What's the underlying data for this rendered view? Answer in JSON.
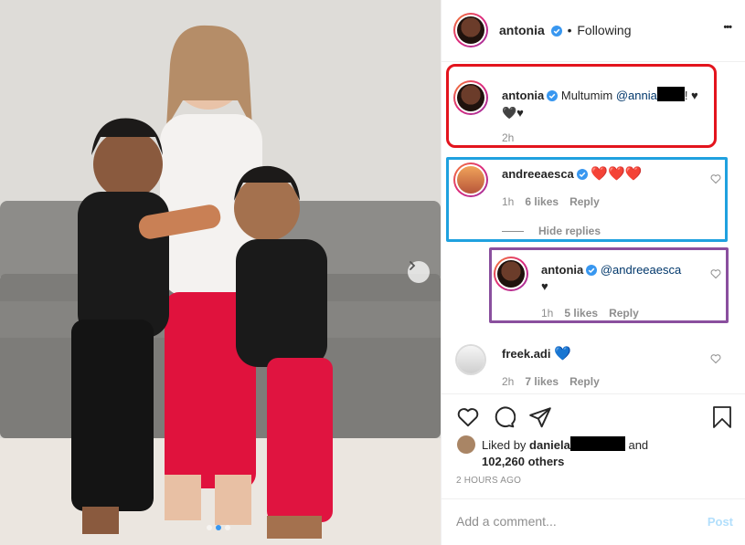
{
  "post": {
    "author": "antonia",
    "dot_separator": "•",
    "follow_status": "Following",
    "more_label": "•••",
    "accent": "#3897f0",
    "verified_color": "#3897f0"
  },
  "caption": {
    "username": "antonia",
    "text_before": "Multumim ",
    "mention": "@annia",
    "text_after": "! ♥",
    "line2": "🖤♥",
    "time": "2h"
  },
  "comments": [
    {
      "username": "andreeaesca",
      "text": "❤️❤️❤️",
      "time": "1h",
      "likes": "6 likes",
      "reply": "Reply",
      "hide_replies": "Hide replies"
    },
    {
      "username": "antonia",
      "mention": "@andreeaesca",
      "text": "♥",
      "time": "1h",
      "likes": "5 likes",
      "reply": "Reply"
    },
    {
      "username": "freek.adi",
      "text": "💙",
      "time": "2h",
      "likes": "7 likes",
      "reply": "Reply"
    }
  ],
  "likes": {
    "prefix": "Liked by ",
    "user": "daniela",
    "and": "and",
    "others": "102,260 others"
  },
  "timestamp": "2 HOURS AGO",
  "add_comment": {
    "placeholder": "Add a comment...",
    "post_label": "Post"
  },
  "highlight_colors": {
    "red": "#e3141d",
    "blue": "#1fa1df",
    "purple": "#8a4f9e"
  },
  "carousel": {
    "current": 2,
    "total": 3
  },
  "icons": [
    "more-icon",
    "heart-icon",
    "comment-icon",
    "share-icon",
    "bookmark-icon",
    "chevron-right-icon",
    "verified-icon"
  ]
}
